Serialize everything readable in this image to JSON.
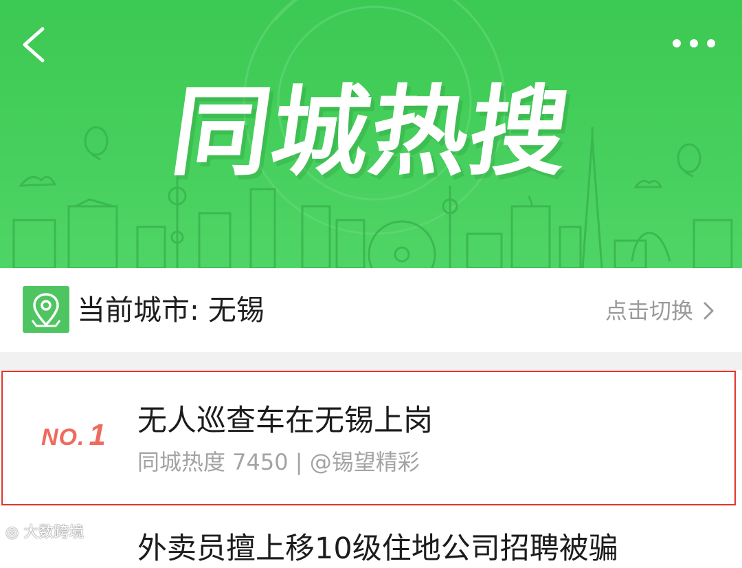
{
  "banner": {
    "title": "同城热搜",
    "back_icon": "chevron-left-icon",
    "more_icon": "ellipsis-icon",
    "colors": {
      "green": "#46cf5c",
      "skyline": "#3fbd54"
    }
  },
  "city": {
    "label": "当前城市: 无锡",
    "switch_label": "点击切换",
    "location_icon": "map-pin-icon",
    "switch_icon": "chevron-right-icon"
  },
  "list": {
    "items": [
      {
        "rank_prefix": "NO.",
        "rank_number": "1",
        "title": "无人巡查车在无锡上岗",
        "meta": "同城热度 7450 | @锡望精彩"
      },
      {
        "title": "外卖员擅上移10级住地公司招聘被骗"
      }
    ]
  },
  "watermark": {
    "text": "大数跨境"
  },
  "colors": {
    "highlight_border": "#e2362b",
    "rank": "#ef6a5f",
    "meta": "#a3a3a3"
  }
}
